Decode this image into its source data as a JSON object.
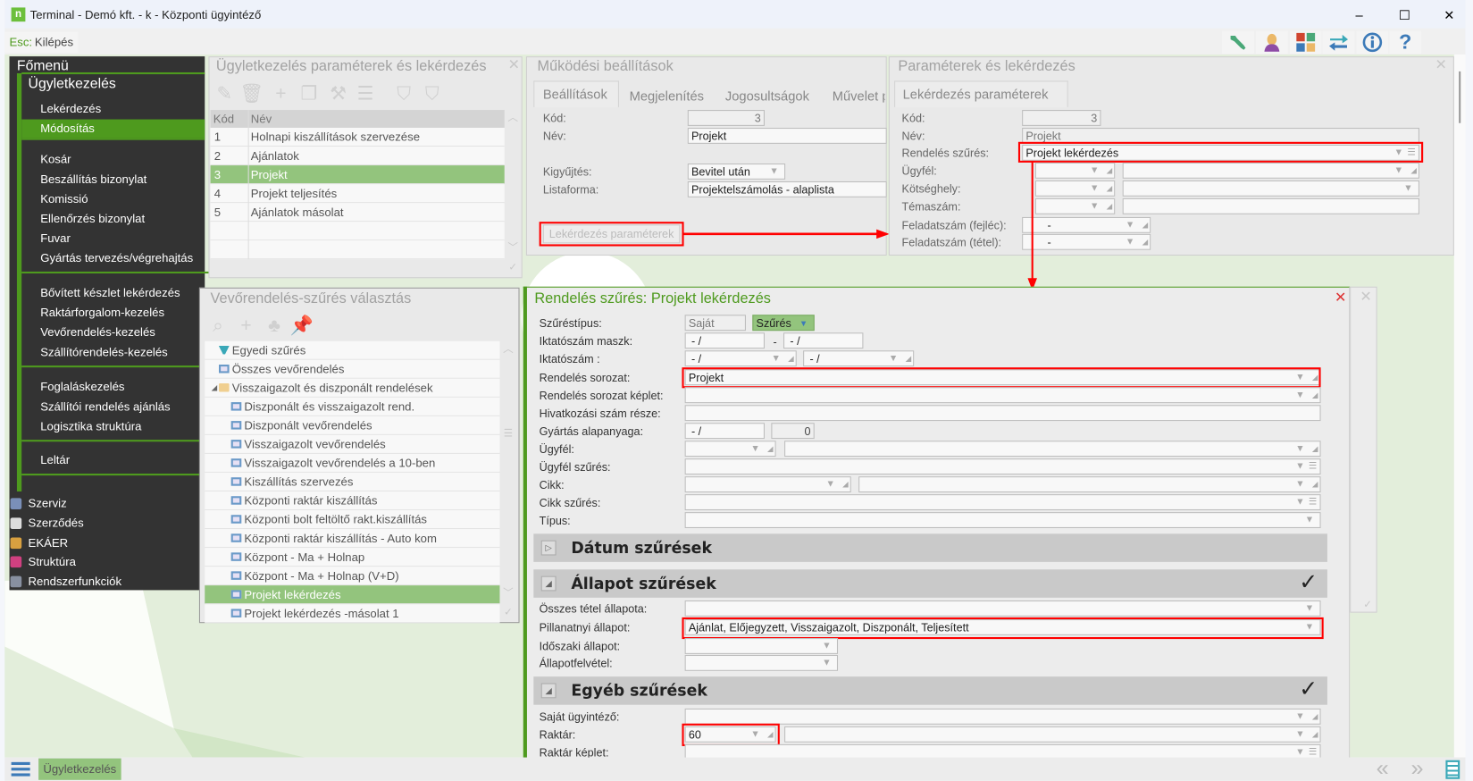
{
  "window": {
    "title": "Terminal - Demó kft. - k - Központi ügyintéző",
    "minimize": "–",
    "maximize": "☐",
    "close": "✕"
  },
  "toolbar": {
    "esc_key": "Esc:",
    "esc_label": "Kilépés",
    "icons": [
      "wrench-icon",
      "user-icon",
      "apps-grid-icon",
      "swap-arrows-icon",
      "info-icon",
      "help-icon"
    ]
  },
  "menu": {
    "title": "Főmenü",
    "section": "Ügyletkezelés",
    "groups": [
      [
        "Lekérdezés",
        "Módosítás"
      ],
      [
        "Kosár",
        "Beszállítás bizonylat",
        "Komissió",
        "Ellenőrzés bizonylat",
        "Fuvar",
        "Gyártás tervezés/végrehajtás"
      ],
      [
        "Bővített készlet lekérdezés",
        "Raktárforgalom-kezelés",
        "Vevőrendelés-kezelés",
        "Szállítórendelés-kezelés"
      ],
      [
        "Foglaláskezelés",
        "Szállítói rendelés ajánlás",
        "Logisztika struktúra"
      ],
      [
        "Leltár"
      ]
    ],
    "selected": "Módosítás",
    "lower": [
      "Szerviz",
      "Szerződés",
      "EKÁER",
      "Struktúra",
      "Rendszerfunkciók"
    ]
  },
  "panel1": {
    "title": "Ügyletkezelés paraméterek és lekérdezés",
    "headers": [
      "Kód",
      "Név"
    ],
    "rows": [
      [
        "1",
        "Holnapi kiszállítások szervezése"
      ],
      [
        "2",
        "Ajánlatok"
      ],
      [
        "3",
        "Projekt"
      ],
      [
        "4",
        "Projekt teljesítés"
      ],
      [
        "5",
        "Ajánlatok másolat"
      ],
      [
        "",
        ""
      ],
      [
        "",
        ""
      ]
    ],
    "selected_index": 2
  },
  "panel2": {
    "title": "Működési beállítások",
    "tabs": [
      "Beállítások",
      "Megjelenítés",
      "Jogosultságok",
      "Művelet p"
    ],
    "kod_label": "Kód:",
    "kod_value": "3",
    "nev_label": "Név:",
    "nev_value": "Projekt",
    "kigy_label": "Kigyűjtés:",
    "kigy_value": "Bevitel után",
    "lista_label": "Listaforma:",
    "lista_value": "Projektelszámolás - alaplista",
    "button": "Lekérdezés paraméterek"
  },
  "panel3": {
    "title": "Paraméterek és lekérdezés",
    "tab": "Lekérdezés paraméterek",
    "kod_label": "Kód:",
    "kod_value": "3",
    "nev_label": "Név:",
    "nev_value": "Projekt",
    "rsz_label": "Rendelés szűrés:",
    "rsz_value": "Projekt lekérdezés",
    "ugyfel_label": "Ügyfél:",
    "koltseg_label": "Kötséghely:",
    "tema_label": "Témaszám:",
    "fej_label": "Feladatszám (fejléc):",
    "fej_value": "-",
    "tetel_label": "Feladatszám (tétel):",
    "tetel_value": "-"
  },
  "panel4": {
    "title": "Vevőrendelés-szűrés választás",
    "items": [
      {
        "label": "Egyedi szűrés",
        "level": 0,
        "icon": "filter-icon"
      },
      {
        "label": "Összes vevőrendelés",
        "level": 0,
        "icon": "monitor-icon"
      },
      {
        "label": "Visszaigazolt és diszponált rendelések",
        "level": 0,
        "icon": "folder-icon",
        "expanded": true
      },
      {
        "label": "Diszponált és visszaigazolt rend.",
        "level": 1,
        "icon": "monitor-icon"
      },
      {
        "label": "Diszponált vevőrendelés",
        "level": 1,
        "icon": "monitor-icon"
      },
      {
        "label": "Visszaigazolt vevőrendelés",
        "level": 1,
        "icon": "monitor-icon"
      },
      {
        "label": "Visszaigazolt vevőrendelés a 10-ben",
        "level": 1,
        "icon": "monitor-icon"
      },
      {
        "label": "Kiszállítás szervezés",
        "level": 1,
        "icon": "monitor-icon"
      },
      {
        "label": "Központi raktár kiszállítás",
        "level": 1,
        "icon": "monitor-icon"
      },
      {
        "label": "Központi bolt feltöltő rakt.kiszállítás",
        "level": 1,
        "icon": "monitor-icon"
      },
      {
        "label": "Központi raktár kiszállítás - Auto kom",
        "level": 1,
        "icon": "monitor-icon"
      },
      {
        "label": "Központ - Ma + Holnap",
        "level": 1,
        "icon": "monitor-icon"
      },
      {
        "label": "Központ - Ma + Holnap  (V+D)",
        "level": 1,
        "icon": "monitor-icon"
      },
      {
        "label": "Projekt lekérdezés",
        "level": 1,
        "icon": "monitor-icon",
        "selected": true
      },
      {
        "label": "Projekt lekérdezés -másolat 1",
        "level": 1,
        "icon": "monitor-icon"
      }
    ]
  },
  "panel5": {
    "title": "Rendelés szűrés: Projekt lekérdezés",
    "szurestipus_label": "Szűréstípus:",
    "szurestipus_own": "Saját",
    "szurestipus_value": "Szűrés",
    "maszk_label": "Iktatószám maszk:",
    "maszk_from": "- /",
    "maszk_sep": "-",
    "maszk_to": "- /",
    "iktato_label": "Iktatószám :",
    "iktato_from": "- /",
    "iktato_to": "- /",
    "sorozat_label": "Rendelés sorozat:",
    "sorozat_value": "Projekt",
    "sorozat_keplet_label": "Rendelés sorozat képlet:",
    "hivatkozas_label": "Hivatkozási szám része:",
    "gyartas_label": "Gyártás alapanyaga:",
    "gyartas_value": "- /",
    "gyartas_qty": "0",
    "ugyfel_label": "Ügyfél:",
    "ugyfel_szures_label": "Ügyfél szűrés:",
    "cikk_label": "Cikk:",
    "cikk_szures_label": "Cikk szűrés:",
    "tipus_label": "Típus:",
    "section_datum": "Dátum szűrések",
    "section_allapot": "Állapot szűrések",
    "osszes_label": "Összes tétel állapota:",
    "pillanatnyi_label": "Pillanatnyi állapot:",
    "pillanatnyi_value": "Ajánlat, Előjegyzett, Visszaigazolt, Diszponált, Teljesített",
    "idoszaki_label": "Időszaki állapot:",
    "felvetel_label": "Állapotfelvétel:",
    "section_egyeb": "Egyéb szűrések",
    "sajat_label": "Saját ügyintéző:",
    "raktar_label": "Raktár:",
    "raktar_value": "60",
    "raktar_keplet_label": "Raktár képlet:",
    "check": "✓"
  },
  "bottom": {
    "tab": "Ügyletkezelés"
  },
  "colors": {
    "accent": "#4e9a1e",
    "selection": "#93c47d",
    "highlight": "#ff0000",
    "menu_bg": "#333333"
  }
}
